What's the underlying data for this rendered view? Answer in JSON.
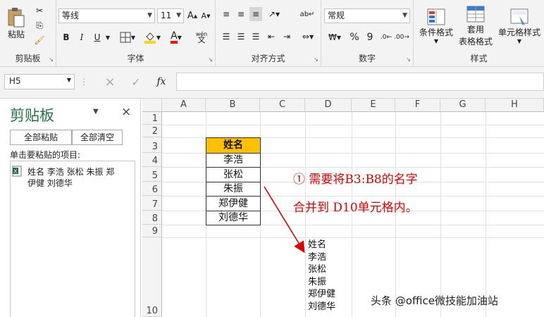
{
  "ribbon": {
    "clipboard": {
      "paste_label": "粘贴",
      "group_label": "剪贴板"
    },
    "font": {
      "font_name": "等线",
      "font_size": "11",
      "bold": "B",
      "italic": "I",
      "underline": "U",
      "group_label": "字体",
      "font_color": "#e11",
      "fill_color": "#ffd700"
    },
    "align": {
      "group_label": "对齐方式"
    },
    "number": {
      "format": "常规",
      "percent": "%",
      "comma": "9",
      "group_label": "数字"
    },
    "styles": {
      "cond_format": "条件格式",
      "table_format_1": "套用",
      "table_format_2": "表格格式",
      "cell_styles": "单元格样式",
      "group_label": "样式"
    }
  },
  "formula_bar": {
    "cell_ref": "H5",
    "fx": "fx",
    "value": ""
  },
  "clipboard_pane": {
    "title": "剪贴板",
    "paste_all": "全部粘贴",
    "clear_all": "全部清空",
    "hint": "单击要粘贴的项目:",
    "item_line1": "姓名 李浩 张松 朱振 郑",
    "item_line2": "伊健 刘德华"
  },
  "sheet": {
    "columns": [
      "A",
      "B",
      "C",
      "D",
      "E",
      "F",
      "G",
      "H"
    ],
    "rows": [
      "1",
      "2",
      "3",
      "4",
      "5",
      "6",
      "7",
      "8",
      "9",
      "10"
    ],
    "header_cell": "姓名",
    "names": [
      "李浩",
      "张松",
      "朱振",
      "郑伊健",
      "刘德华"
    ],
    "d10_lines": [
      "姓名",
      "李浩",
      "张松",
      "朱振",
      "郑伊健",
      "刘德华"
    ],
    "header_fill": "#ffc000"
  },
  "annotation": {
    "line1": "①  需要将B3:B8的名字",
    "line2": "合并到 D10单元格内。",
    "color": "#e00000"
  },
  "watermark": "头条 @office微技能加油站"
}
